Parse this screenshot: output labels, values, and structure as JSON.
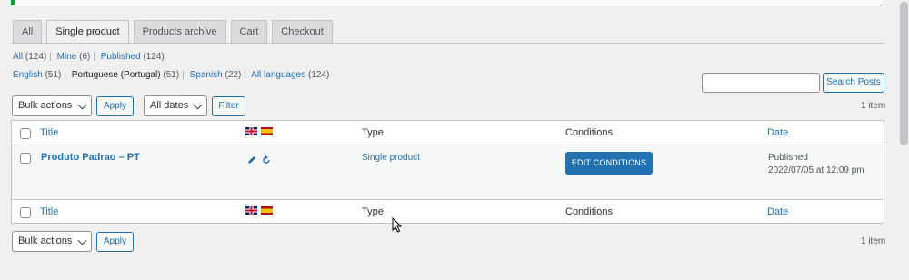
{
  "tabs": [
    {
      "label": "All",
      "active": false
    },
    {
      "label": "Single product",
      "active": true
    },
    {
      "label": "Products archive",
      "active": false
    },
    {
      "label": "Cart",
      "active": false
    },
    {
      "label": "Checkout",
      "active": false
    }
  ],
  "views": {
    "all": {
      "label": "All",
      "count": "(124)"
    },
    "mine": {
      "label": "Mine",
      "count": "(6)"
    },
    "published": {
      "label": "Published",
      "count": "(124)"
    }
  },
  "languages": {
    "english": {
      "label": "English",
      "count": "(51)"
    },
    "portuguese": {
      "label": "Portuguese (Portugal)",
      "count": "(51)"
    },
    "spanish": {
      "label": "Spanish",
      "count": "(22)"
    },
    "all": {
      "label": "All languages",
      "count": "(124)"
    }
  },
  "search": {
    "value": "",
    "button_label": "Search Posts"
  },
  "filters_top": {
    "bulk_actions": "Bulk actions",
    "apply_label": "Apply",
    "dates": "All dates",
    "filter_label": "Filter",
    "items_count": "1 item"
  },
  "table": {
    "columns": {
      "title": "Title",
      "type": "Type",
      "conditions": "Conditions",
      "date": "Date"
    },
    "flags": [
      "flag-uk",
      "flag-es"
    ],
    "rows": [
      {
        "title": "Produto Padrao – PT",
        "type": "Single product",
        "conditions_button": "EDIT CONDITIONS",
        "status": "Published",
        "date": "2022/07/05 at 12:09 pm",
        "language_icons": [
          "pencil-icon",
          "sync-icon"
        ]
      }
    ]
  },
  "filters_bottom": {
    "bulk_actions": "Bulk actions",
    "apply_label": "Apply",
    "items_count": "1 item"
  },
  "colors": {
    "accent": "#2271b1",
    "success": "#00a32a",
    "border": "#c3c4c7"
  }
}
